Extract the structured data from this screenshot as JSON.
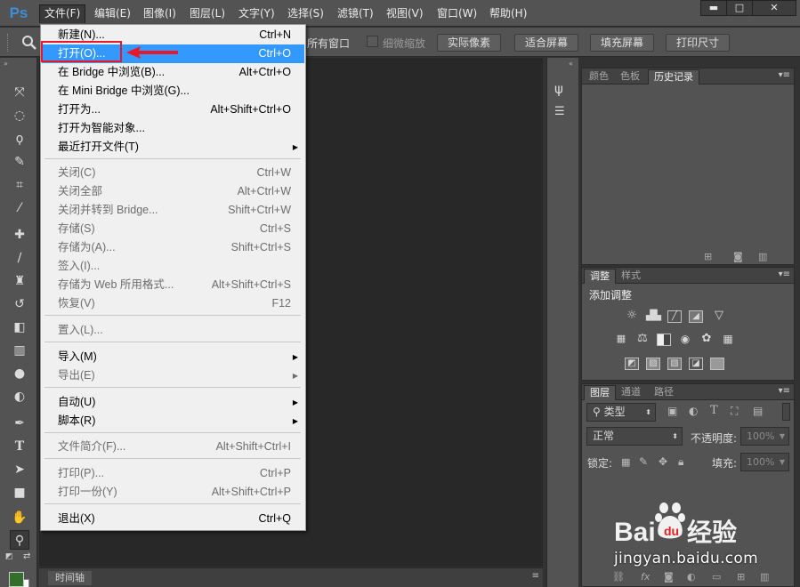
{
  "app": {
    "logo": "Ps"
  },
  "menubar": {
    "items": [
      "文件(F)",
      "编辑(E)",
      "图像(I)",
      "图层(L)",
      "文字(Y)",
      "选择(S)",
      "滤镜(T)",
      "视图(V)",
      "窗口(W)",
      "帮助(H)"
    ],
    "active": "文件(F)"
  },
  "window_controls": {
    "minimize": "▬",
    "maximize": "□",
    "close": "✕"
  },
  "options_bar": {
    "all_windows_label": "所有窗口",
    "scrubby_zoom_label": "细微缩放",
    "actual_pixels": "实际像素",
    "fit_screen": "适合屏幕",
    "fill_screen": "填充屏幕",
    "print_size": "打印尺寸"
  },
  "file_menu": {
    "items": [
      {
        "label": "新建(N)...",
        "shortcut": "Ctrl+N"
      },
      {
        "label": "打开(O)...",
        "shortcut": "Ctrl+O",
        "highlighted": true
      },
      {
        "label": "在 Bridge 中浏览(B)...",
        "shortcut": "Alt+Ctrl+O"
      },
      {
        "label": "在 Mini Bridge 中浏览(G)...",
        "shortcut": ""
      },
      {
        "label": "打开为...",
        "shortcut": "Alt+Shift+Ctrl+O"
      },
      {
        "label": "打开为智能对象...",
        "shortcut": ""
      },
      {
        "label": "最近打开文件(T)",
        "shortcut": "",
        "submenu": true
      },
      {
        "label": "关闭(C)",
        "shortcut": "Ctrl+W",
        "disabled": true
      },
      {
        "label": "关闭全部",
        "shortcut": "Alt+Ctrl+W",
        "disabled": true
      },
      {
        "label": "关闭并转到 Bridge...",
        "shortcut": "Shift+Ctrl+W",
        "disabled": true
      },
      {
        "label": "存储(S)",
        "shortcut": "Ctrl+S",
        "disabled": true
      },
      {
        "label": "存储为(A)...",
        "shortcut": "Shift+Ctrl+S",
        "disabled": true
      },
      {
        "label": "签入(I)...",
        "shortcut": "",
        "disabled": true
      },
      {
        "label": "存储为 Web 所用格式...",
        "shortcut": "Alt+Shift+Ctrl+S",
        "disabled": true
      },
      {
        "label": "恢复(V)",
        "shortcut": "F12",
        "disabled": true
      },
      {
        "label": "置入(L)...",
        "shortcut": "",
        "disabled": true
      },
      {
        "label": "导入(M)",
        "shortcut": "",
        "submenu": true
      },
      {
        "label": "导出(E)",
        "shortcut": "",
        "submenu": true,
        "disabled": true
      },
      {
        "label": "自动(U)",
        "shortcut": "",
        "submenu": true
      },
      {
        "label": "脚本(R)",
        "shortcut": "",
        "submenu": true
      },
      {
        "label": "文件简介(F)...",
        "shortcut": "Alt+Shift+Ctrl+I",
        "disabled": true
      },
      {
        "label": "打印(P)...",
        "shortcut": "Ctrl+P",
        "disabled": true
      },
      {
        "label": "打印一份(Y)",
        "shortcut": "Alt+Shift+Ctrl+P",
        "disabled": true
      },
      {
        "label": "退出(X)",
        "shortcut": "Ctrl+Q"
      }
    ]
  },
  "panels": {
    "top": {
      "tabs": [
        "颜色",
        "色板",
        "历史记录"
      ],
      "active": "历史记录"
    },
    "adjustments": {
      "tabs": [
        "调整",
        "样式"
      ],
      "active": "调整",
      "heading": "添加调整"
    },
    "layers": {
      "tabs": [
        "图层",
        "通道",
        "路径"
      ],
      "active": "图层",
      "filter_label": "类型",
      "blend_mode": "正常",
      "opacity_label": "不透明度:",
      "opacity_value": "100%",
      "lock_label": "锁定:",
      "fill_label": "填充:",
      "fill_value": "100%"
    }
  },
  "timeline": {
    "label": "时间轴"
  },
  "watermark": {
    "brand": "Bai du 经验",
    "url": "jingyan.baidu.com"
  },
  "colors": {
    "foreground": "#346e2d",
    "background": "#ffffff",
    "highlight": "#3399ff",
    "callout": "#e8182a"
  }
}
